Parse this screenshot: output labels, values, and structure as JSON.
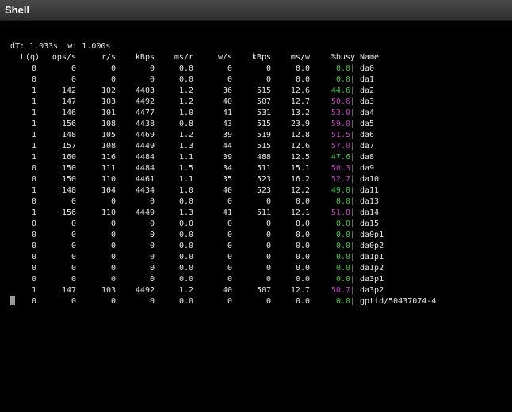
{
  "window": {
    "title": "Shell"
  },
  "status_line": "dT: 1.033s  w: 1.000s",
  "headers": [
    "L(q)",
    "ops/s",
    "r/s",
    "kBps",
    "ms/r",
    "w/s",
    "kBps",
    "ms/w",
    "%busy",
    "Name"
  ],
  "rows": [
    {
      "q": "0",
      "ops": "0",
      "r": "0",
      "rk": "0",
      "msr": "0.0",
      "w": "0",
      "wk": "0",
      "msw": "0.0",
      "busy": "0.0",
      "name": "da0"
    },
    {
      "q": "0",
      "ops": "0",
      "r": "0",
      "rk": "0",
      "msr": "0.0",
      "w": "0",
      "wk": "0",
      "msw": "0.0",
      "busy": "0.0",
      "name": "da1"
    },
    {
      "q": "1",
      "ops": "142",
      "r": "102",
      "rk": "4403",
      "msr": "1.2",
      "w": "36",
      "wk": "515",
      "msw": "12.6",
      "busy": "44.6",
      "name": "da2"
    },
    {
      "q": "1",
      "ops": "147",
      "r": "103",
      "rk": "4492",
      "msr": "1.2",
      "w": "40",
      "wk": "507",
      "msw": "12.7",
      "busy": "50.6",
      "name": "da3"
    },
    {
      "q": "1",
      "ops": "146",
      "r": "101",
      "rk": "4477",
      "msr": "1.0",
      "w": "41",
      "wk": "531",
      "msw": "13.2",
      "busy": "53.0",
      "name": "da4"
    },
    {
      "q": "1",
      "ops": "156",
      "r": "108",
      "rk": "4438",
      "msr": "0.8",
      "w": "43",
      "wk": "515",
      "msw": "23.9",
      "busy": "59.0",
      "name": "da5"
    },
    {
      "q": "1",
      "ops": "148",
      "r": "105",
      "rk": "4469",
      "msr": "1.2",
      "w": "39",
      "wk": "519",
      "msw": "12.8",
      "busy": "51.5",
      "name": "da6"
    },
    {
      "q": "1",
      "ops": "157",
      "r": "108",
      "rk": "4449",
      "msr": "1.3",
      "w": "44",
      "wk": "515",
      "msw": "12.6",
      "busy": "57.0",
      "name": "da7"
    },
    {
      "q": "1",
      "ops": "160",
      "r": "116",
      "rk": "4484",
      "msr": "1.1",
      "w": "39",
      "wk": "488",
      "msw": "12.5",
      "busy": "47.6",
      "name": "da8"
    },
    {
      "q": "0",
      "ops": "150",
      "r": "111",
      "rk": "4484",
      "msr": "1.5",
      "w": "34",
      "wk": "511",
      "msw": "15.1",
      "busy": "50.3",
      "name": "da9"
    },
    {
      "q": "0",
      "ops": "150",
      "r": "110",
      "rk": "4461",
      "msr": "1.1",
      "w": "35",
      "wk": "523",
      "msw": "16.2",
      "busy": "52.7",
      "name": "da10"
    },
    {
      "q": "1",
      "ops": "148",
      "r": "104",
      "rk": "4434",
      "msr": "1.0",
      "w": "40",
      "wk": "523",
      "msw": "12.2",
      "busy": "49.0",
      "name": "da11"
    },
    {
      "q": "0",
      "ops": "0",
      "r": "0",
      "rk": "0",
      "msr": "0.0",
      "w": "0",
      "wk": "0",
      "msw": "0.0",
      "busy": "0.0",
      "name": "da13"
    },
    {
      "q": "1",
      "ops": "156",
      "r": "110",
      "rk": "4449",
      "msr": "1.3",
      "w": "41",
      "wk": "511",
      "msw": "12.1",
      "busy": "51.8",
      "name": "da14"
    },
    {
      "q": "0",
      "ops": "0",
      "r": "0",
      "rk": "0",
      "msr": "0.0",
      "w": "0",
      "wk": "0",
      "msw": "0.0",
      "busy": "0.0",
      "name": "da15"
    },
    {
      "q": "0",
      "ops": "0",
      "r": "0",
      "rk": "0",
      "msr": "0.0",
      "w": "0",
      "wk": "0",
      "msw": "0.0",
      "busy": "0.0",
      "name": "da0p1"
    },
    {
      "q": "0",
      "ops": "0",
      "r": "0",
      "rk": "0",
      "msr": "0.0",
      "w": "0",
      "wk": "0",
      "msw": "0.0",
      "busy": "0.0",
      "name": "da0p2"
    },
    {
      "q": "0",
      "ops": "0",
      "r": "0",
      "rk": "0",
      "msr": "0.0",
      "w": "0",
      "wk": "0",
      "msw": "0.0",
      "busy": "0.0",
      "name": "da1p1"
    },
    {
      "q": "0",
      "ops": "0",
      "r": "0",
      "rk": "0",
      "msr": "0.0",
      "w": "0",
      "wk": "0",
      "msw": "0.0",
      "busy": "0.0",
      "name": "da1p2"
    },
    {
      "q": "0",
      "ops": "0",
      "r": "0",
      "rk": "0",
      "msr": "0.0",
      "w": "0",
      "wk": "0",
      "msw": "0.0",
      "busy": "0.0",
      "name": "da3p1"
    },
    {
      "q": "1",
      "ops": "147",
      "r": "103",
      "rk": "4492",
      "msr": "1.2",
      "w": "40",
      "wk": "507",
      "msw": "12.7",
      "busy": "50.7",
      "name": "da3p2"
    },
    {
      "q": "0",
      "ops": "0",
      "r": "0",
      "rk": "0",
      "msr": "0.0",
      "w": "0",
      "wk": "0",
      "msw": "0.0",
      "busy": "0.0",
      "name": "gptid/50437074-4"
    }
  ],
  "colors": {
    "background": "#000000",
    "text": "#e6e6e6",
    "busy_low": "#3fd03f",
    "busy_high": "#c63fc6",
    "titlebar": "#3a3a3a"
  }
}
